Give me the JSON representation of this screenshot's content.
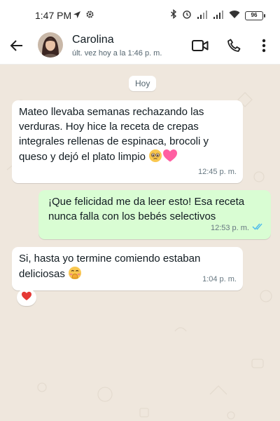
{
  "status_bar": {
    "time": "1:47 PM",
    "battery": "96",
    "icons": [
      "location-arrow-icon",
      "settings-icon",
      "bluetooth-icon",
      "alarm-icon",
      "signal-icon",
      "signal-icon",
      "wifi-icon",
      "battery-icon"
    ]
  },
  "header": {
    "contact_name": "Carolina",
    "contact_status": "últ. vez hoy a la 1:46 p. m.",
    "icons": [
      "back-arrow-icon",
      "video-call-icon",
      "voice-call-icon",
      "more-options-icon"
    ]
  },
  "chat": {
    "date_divider": "Hoy",
    "messages": [
      {
        "direction": "incoming",
        "text": "Mateo llevaba semanas rechazando las verduras. Hoy hice la receta de crepas integrales rellenas de espinaca, brocoli y queso y dejó el plato limpio",
        "emojis": [
          "pleading-face",
          "pink-heart"
        ],
        "time": "12:45 p. m."
      },
      {
        "direction": "outgoing",
        "text": "¡Que felicidad me da leer esto! Esa receta nunca falla con los bebés selectivos",
        "time": "12:53 p. m.",
        "status": "read"
      },
      {
        "direction": "incoming",
        "text": "Si, hasta yo termine comiendo estaban deliciosas",
        "emojis": [
          "hand-over-mouth-face"
        ],
        "time": "1:04 p. m.",
        "reaction": "red-heart"
      }
    ]
  },
  "colors": {
    "chat_background": "#efe7dd",
    "incoming_bubble": "#ffffff",
    "outgoing_bubble": "#d9fdd3",
    "read_ticks": "#53bdeb"
  }
}
